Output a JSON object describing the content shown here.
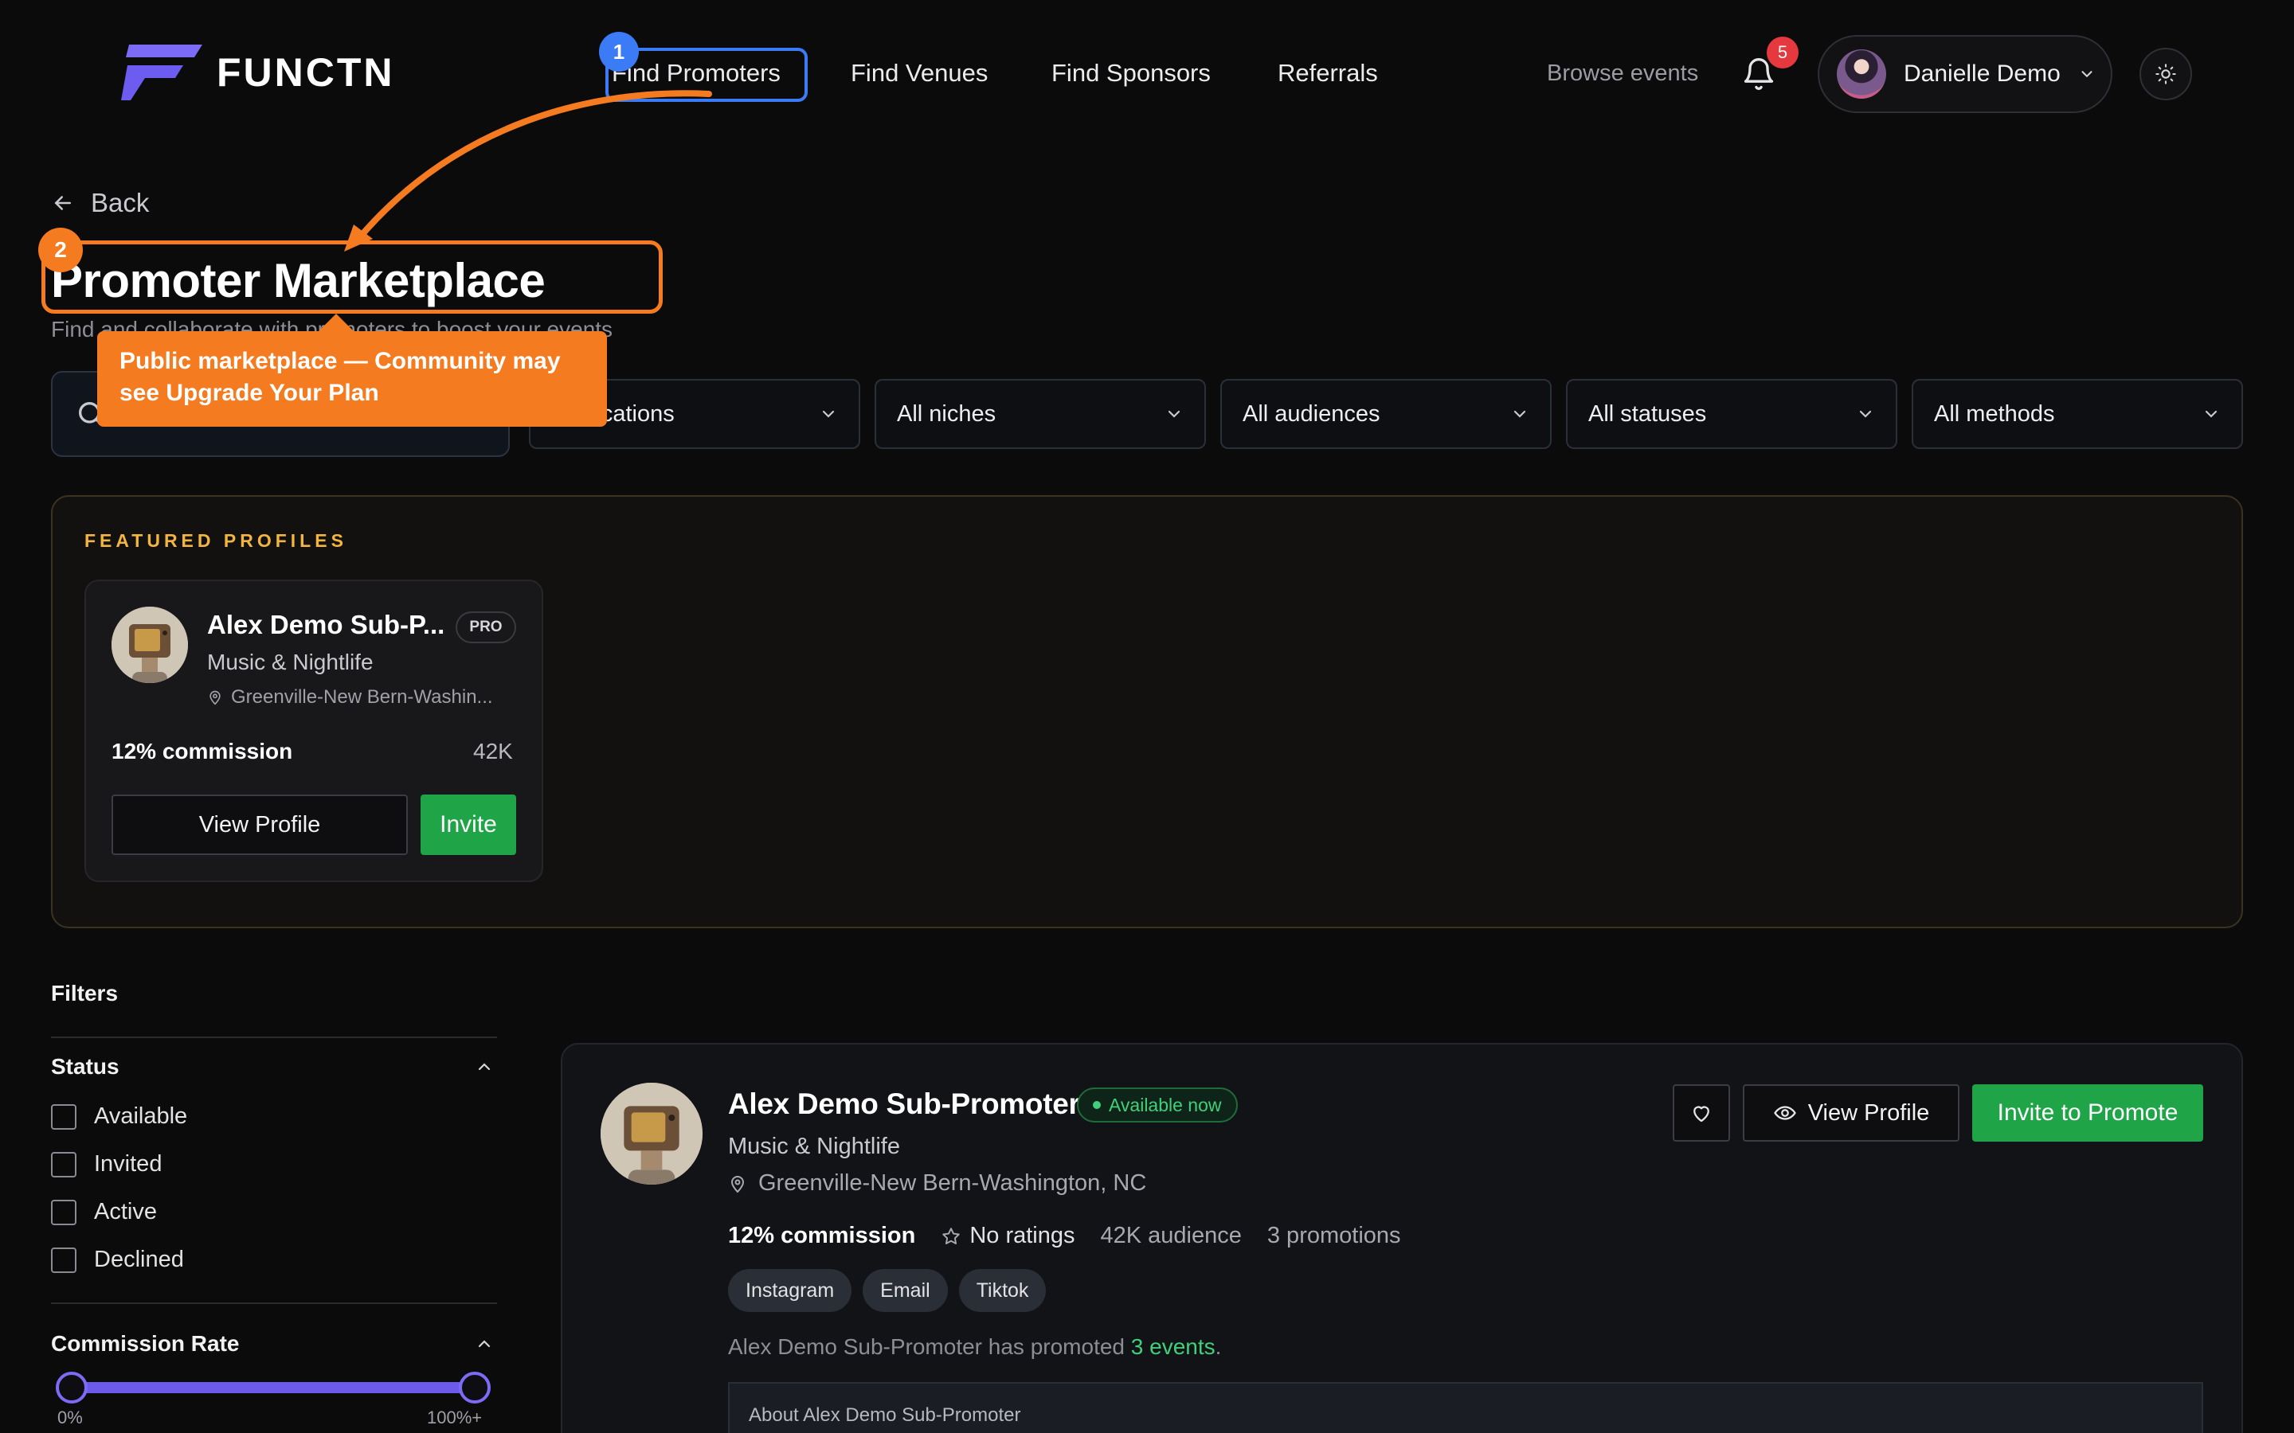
{
  "brand": {
    "name": "FUNCTN",
    "accent": "#6c5cf0"
  },
  "nav": {
    "items": [
      "Find Promoters",
      "Find Venues",
      "Find Sponsors",
      "Referrals"
    ],
    "browse": "Browse events",
    "notifications_count": "5",
    "user_name": "Danielle Demo"
  },
  "annotations": {
    "step1": "1",
    "step2": "2",
    "tooltip": "Public marketplace — Community may see Upgrade Your Plan"
  },
  "page": {
    "back": "Back",
    "title": "Promoter Marketplace",
    "subtitle": "Find and collaborate with promoters to boost your events"
  },
  "filter_bar": {
    "locations": "All locations",
    "niches": "All niches",
    "audiences": "All audiences",
    "statuses": "All statuses",
    "methods": "All methods"
  },
  "featured": {
    "label": "FEATURED PROFILES",
    "card": {
      "name": "Alex Demo Sub-P...",
      "badge": "PRO",
      "niche": "Music & Nightlife",
      "location": "Greenville-New Bern-Washin...",
      "commission": "12% commission",
      "audience": "42K",
      "view_label": "View Profile",
      "invite_label": "Invite"
    }
  },
  "sidebar": {
    "title": "Filters",
    "status": {
      "title": "Status",
      "options": [
        "Available",
        "Invited",
        "Active",
        "Declined"
      ]
    },
    "commission": {
      "title": "Commission Rate",
      "min_label": "0%",
      "max_label": "100%+"
    }
  },
  "promoter": {
    "name": "Alex Demo Sub-Promoter",
    "availability": "Available now",
    "niche": "Music & Nightlife",
    "location": "Greenville-New Bern-Washington, NC",
    "commission": "12% commission",
    "ratings": "No ratings",
    "audience": "42K audience",
    "promotions": "3 promotions",
    "tags": [
      "Instagram",
      "Email",
      "Tiktok"
    ],
    "promoted_prefix": "Alex Demo Sub-Promoter has promoted ",
    "promoted_events": "3 events",
    "promoted_suffix": ".",
    "about_title": "About Alex Demo Sub-Promoter",
    "view_label": "View Profile",
    "invite_label": "Invite to Promote"
  }
}
